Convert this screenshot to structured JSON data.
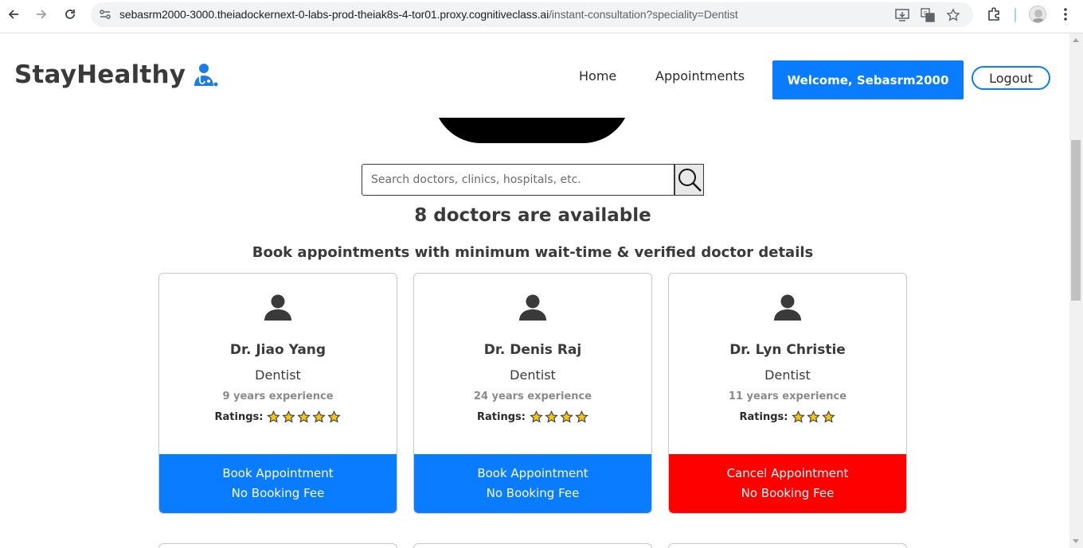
{
  "browser": {
    "url_host": "sebasrm2000-3000.theiadockernext-0-labs-prod-theiak8s-4-tor01.proxy.cognitiveclass.ai",
    "url_path": "/instant-consultation?speciality=Dentist",
    "icons": [
      "back-icon",
      "forward-icon",
      "reload-icon",
      "site-info-icon",
      "install-app-icon",
      "translate-icon",
      "bookmark-star-icon",
      "extensions-icon",
      "profile-avatar",
      "kebab-menu-icon"
    ]
  },
  "header": {
    "brand": "StayHealthy",
    "nav": {
      "home": "Home",
      "appointments": "Appointments"
    },
    "welcome": "Welcome, Sebasrm2000",
    "logout": "Logout",
    "accent_color": "#0a7cff"
  },
  "search": {
    "placeholder": "Search doctors, clinics, hospitals, etc."
  },
  "results": {
    "count_title": "8 doctors are available",
    "subtitle": "Book appointments with minimum wait-time & verified doctor details"
  },
  "ratings_label": "Ratings:",
  "doctors": [
    {
      "name": "Dr. Jiao Yang",
      "speciality": "Dentist",
      "experience": "9 years experience",
      "stars": 5,
      "action_line1": "Book Appointment",
      "action_line2": "No Booking Fee",
      "action_type": "book",
      "action_color": "#0a7cff"
    },
    {
      "name": "Dr. Denis Raj",
      "speciality": "Dentist",
      "experience": "24 years experience",
      "stars": 4,
      "action_line1": "Book Appointment",
      "action_line2": "No Booking Fee",
      "action_type": "book",
      "action_color": "#0a7cff"
    },
    {
      "name": "Dr. Lyn Christie",
      "speciality": "Dentist",
      "experience": "11 years experience",
      "stars": 3,
      "action_line1": "Cancel Appointment",
      "action_line2": "No Booking Fee",
      "action_type": "cancel",
      "action_color": "#ff0000"
    }
  ]
}
